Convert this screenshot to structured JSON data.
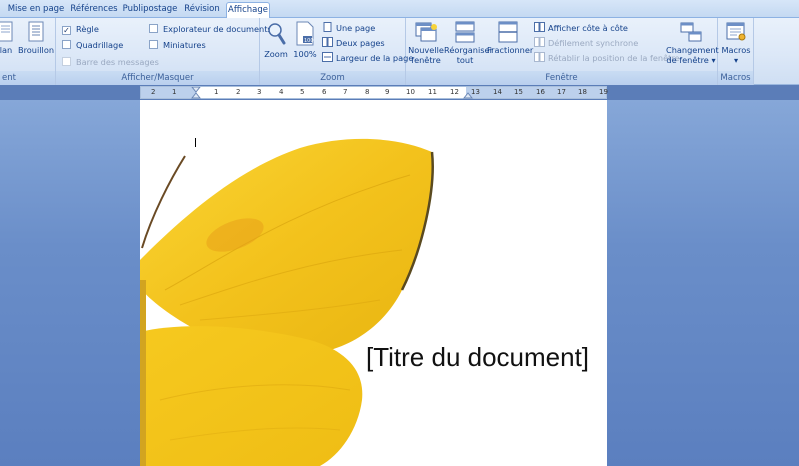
{
  "tabs": [
    {
      "label": "Mise en page",
      "active": false
    },
    {
      "label": "Références",
      "active": false
    },
    {
      "label": "Publipostage",
      "active": false
    },
    {
      "label": "Révision",
      "active": false
    },
    {
      "label": "Affichage",
      "active": true
    }
  ],
  "ribbon": {
    "views": {
      "group_label": "ent",
      "lan_label": "lan",
      "brouillon_label": "Brouillon"
    },
    "show_hide": {
      "group_label": "Afficher/Masquer",
      "regle": {
        "label": "Règle",
        "checked": true
      },
      "quadrillage": {
        "label": "Quadrillage",
        "checked": false
      },
      "barre": {
        "label": "Barre des messages",
        "checked": false,
        "disabled": true
      },
      "explorateur": {
        "label": "Explorateur de documents",
        "checked": false
      },
      "miniatures": {
        "label": "Miniatures",
        "checked": false
      }
    },
    "zoom": {
      "group_label": "Zoom",
      "zoom_label": "Zoom",
      "hundred_label": "100%",
      "une_page": "Une page",
      "deux_pages": "Deux pages",
      "largeur": "Largeur de la page"
    },
    "fenetre": {
      "group_label": "Fenêtre",
      "nouvelle_l1": "Nouvelle",
      "nouvelle_l2": "fenêtre",
      "reorganiser_l1": "Réorganiser",
      "reorganiser_l2": "tout",
      "fractionner": "Fractionner",
      "afficher_cote": "Afficher côte à côte",
      "defilement": "Défilement synchrone",
      "retablir": "Rétablir la position de la fenêtre",
      "changement_l1": "Changement",
      "changement_l2": "de fenêtre"
    },
    "macros": {
      "group_label": "Macros",
      "label": "Macros"
    }
  },
  "ruler": {
    "ticks": [
      "2",
      "1",
      "1",
      "2",
      "3",
      "4",
      "5",
      "6",
      "7",
      "8",
      "9",
      "10",
      "11",
      "12",
      "13",
      "14",
      "15",
      "16",
      "17",
      "18",
      "19"
    ]
  },
  "document": {
    "title_placeholder": "[Titre du document]"
  },
  "colors": {
    "accent": "#15428b",
    "butterfly": "#f2c21b",
    "ribbon_bg": "#dbe7f7",
    "workspace": "#6a8ec9"
  }
}
